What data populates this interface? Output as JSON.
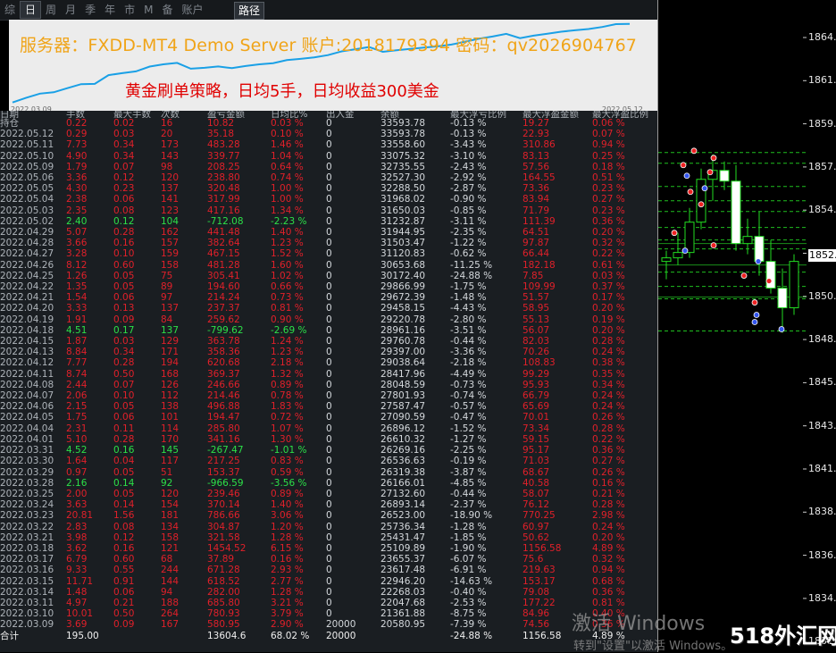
{
  "toolbar": {
    "buttons": [
      "综",
      "日",
      "周",
      "月",
      "季",
      "年",
      "市",
      "M",
      "备",
      "账户"
    ],
    "active": "日",
    "path_label": "路径"
  },
  "equity_chart": {
    "server_line": "服务器：FXDD-MT4 Demo Server  账户:2018179394    密码：qv2026904767",
    "strategy_line": "黄金刷单策略，日均5手，日均收益300美金",
    "start_date": "2022.03.09",
    "end_date": "2022.05.12",
    "line_color": "#1aa0e6",
    "balance_series": [
      20580.95,
      21361.88,
      22047.68,
      22268.03,
      22946.2,
      23617.48,
      23655.37,
      25109.89,
      25431.47,
      25736.34,
      26523.0,
      26893.14,
      27132.6,
      26166.01,
      26319.38,
      26536.63,
      26269.16,
      26610.32,
      26896.12,
      27090.59,
      27587.47,
      27801.93,
      28048.59,
      28417.96,
      29038.64,
      29397.0,
      29760.78,
      28961.16,
      29220.78,
      29458.15,
      29672.39,
      29866.99,
      30172.4,
      30653.68,
      31120.83,
      31503.47,
      31944.95,
      31232.87,
      31650.03,
      31968.02,
      32288.5,
      32527.3,
      32735.55,
      33075.32,
      33558.6,
      33593.78
    ]
  },
  "stats_table": {
    "headers": [
      "日期",
      "手数",
      "最大手数",
      "次数",
      "盈亏金额",
      "日均比%",
      "出入金",
      "余额",
      "最大浮亏比例",
      "最大浮盈金额",
      "最大浮盈比例"
    ],
    "rows": [
      {
        "date": "持仓",
        "lots": "0.22",
        "max_lots": "0.02",
        "trades": "16",
        "pnl": "10.82",
        "pct": "0.03 %",
        "io": "0",
        "balance": "33593.78",
        "dd": "-0.13 %",
        "fp": "19.27",
        "fpp": "0.06 %",
        "neg": false
      },
      {
        "date": "2022.05.12",
        "lots": "0.29",
        "max_lots": "0.03",
        "trades": "20",
        "pnl": "35.18",
        "pct": "0.10 %",
        "io": "0",
        "balance": "33593.78",
        "dd": "-0.13 %",
        "fp": "22.93",
        "fpp": "0.07 %",
        "neg": false
      },
      {
        "date": "2022.05.11",
        "lots": "7.73",
        "max_lots": "0.34",
        "trades": "173",
        "pnl": "483.28",
        "pct": "1.46 %",
        "io": "0",
        "balance": "33558.60",
        "dd": "-3.43 %",
        "fp": "310.86",
        "fpp": "0.94 %",
        "neg": false
      },
      {
        "date": "2022.05.10",
        "lots": "4.90",
        "max_lots": "0.34",
        "trades": "143",
        "pnl": "339.77",
        "pct": "1.04 %",
        "io": "0",
        "balance": "33075.32",
        "dd": "-3.10 %",
        "fp": "83.13",
        "fpp": "0.25 %",
        "neg": false
      },
      {
        "date": "2022.05.09",
        "lots": "1.79",
        "max_lots": "0.07",
        "trades": "98",
        "pnl": "208.25",
        "pct": "0.64 %",
        "io": "0",
        "balance": "32735.55",
        "dd": "-2.43 %",
        "fp": "57.56",
        "fpp": "0.18 %",
        "neg": false
      },
      {
        "date": "2022.05.06",
        "lots": "3.36",
        "max_lots": "0.12",
        "trades": "120",
        "pnl": "238.80",
        "pct": "0.74 %",
        "io": "0",
        "balance": "32527.30",
        "dd": "-2.92 %",
        "fp": "164.55",
        "fpp": "0.51 %",
        "neg": false
      },
      {
        "date": "2022.05.05",
        "lots": "4.30",
        "max_lots": "0.23",
        "trades": "137",
        "pnl": "320.48",
        "pct": "1.00 %",
        "io": "0",
        "balance": "32288.50",
        "dd": "-2.87 %",
        "fp": "73.36",
        "fpp": "0.23 %",
        "neg": false
      },
      {
        "date": "2022.05.04",
        "lots": "2.38",
        "max_lots": "0.06",
        "trades": "141",
        "pnl": "317.99",
        "pct": "1.00 %",
        "io": "0",
        "balance": "31968.02",
        "dd": "-0.90 %",
        "fp": "83.94",
        "fpp": "0.27 %",
        "neg": false
      },
      {
        "date": "2022.05.03",
        "lots": "2.35",
        "max_lots": "0.08",
        "trades": "123",
        "pnl": "417.16",
        "pct": "1.34 %",
        "io": "0",
        "balance": "31650.03",
        "dd": "-0.85 %",
        "fp": "71.79",
        "fpp": "0.23 %",
        "neg": false
      },
      {
        "date": "2022.05.02",
        "lots": "2.40",
        "max_lots": "0.12",
        "trades": "104",
        "pnl": "-712.08",
        "pct": "-2.23 %",
        "io": "0",
        "balance": "31232.87",
        "dd": "-3.11 %",
        "fp": "111.39",
        "fpp": "0.36 %",
        "neg": true
      },
      {
        "date": "2022.04.29",
        "lots": "5.07",
        "max_lots": "0.28",
        "trades": "162",
        "pnl": "441.48",
        "pct": "1.40 %",
        "io": "0",
        "balance": "31944.95",
        "dd": "-2.35 %",
        "fp": "64.51",
        "fpp": "0.20 %",
        "neg": false
      },
      {
        "date": "2022.04.28",
        "lots": "3.66",
        "max_lots": "0.16",
        "trades": "157",
        "pnl": "382.64",
        "pct": "1.23 %",
        "io": "0",
        "balance": "31503.47",
        "dd": "-1.22 %",
        "fp": "97.87",
        "fpp": "0.32 %",
        "neg": false
      },
      {
        "date": "2022.04.27",
        "lots": "3.28",
        "max_lots": "0.10",
        "trades": "159",
        "pnl": "467.15",
        "pct": "1.52 %",
        "io": "0",
        "balance": "31120.83",
        "dd": "-0.62 %",
        "fp": "66.44",
        "fpp": "0.22 %",
        "neg": false
      },
      {
        "date": "2022.04.26",
        "lots": "8.12",
        "max_lots": "0.60",
        "trades": "158",
        "pnl": "481.28",
        "pct": "1.60 %",
        "io": "0",
        "balance": "30653.68",
        "dd": "-11.25 %",
        "fp": "182.18",
        "fpp": "0.61 %",
        "neg": false
      },
      {
        "date": "2022.04.25",
        "lots": "1.26",
        "max_lots": "0.05",
        "trades": "75",
        "pnl": "305.41",
        "pct": "1.02 %",
        "io": "0",
        "balance": "30172.40",
        "dd": "-24.88 %",
        "fp": "7.85",
        "fpp": "0.03 %",
        "neg": false
      },
      {
        "date": "2022.04.22",
        "lots": "1.35",
        "max_lots": "0.05",
        "trades": "89",
        "pnl": "194.60",
        "pct": "0.66 %",
        "io": "0",
        "balance": "29866.99",
        "dd": "-1.75 %",
        "fp": "109.99",
        "fpp": "0.37 %",
        "neg": false
      },
      {
        "date": "2022.04.21",
        "lots": "1.54",
        "max_lots": "0.06",
        "trades": "97",
        "pnl": "214.24",
        "pct": "0.73 %",
        "io": "0",
        "balance": "29672.39",
        "dd": "-1.48 %",
        "fp": "51.57",
        "fpp": "0.17 %",
        "neg": false
      },
      {
        "date": "2022.04.20",
        "lots": "3.33",
        "max_lots": "0.13",
        "trades": "137",
        "pnl": "237.37",
        "pct": "0.81 %",
        "io": "0",
        "balance": "29458.15",
        "dd": "-4.43 %",
        "fp": "58.95",
        "fpp": "0.20 %",
        "neg": false
      },
      {
        "date": "2022.04.19",
        "lots": "1.91",
        "max_lots": "0.09",
        "trades": "84",
        "pnl": "259.62",
        "pct": "0.90 %",
        "io": "0",
        "balance": "29220.78",
        "dd": "-2.80 %",
        "fp": "55.13",
        "fpp": "0.19 %",
        "neg": false
      },
      {
        "date": "2022.04.18",
        "lots": "4.51",
        "max_lots": "0.17",
        "trades": "137",
        "pnl": "-799.62",
        "pct": "-2.69 %",
        "io": "0",
        "balance": "28961.16",
        "dd": "-3.51 %",
        "fp": "56.07",
        "fpp": "0.20 %",
        "neg": true
      },
      {
        "date": "2022.04.15",
        "lots": "1.87",
        "max_lots": "0.03",
        "trades": "129",
        "pnl": "363.78",
        "pct": "1.24 %",
        "io": "0",
        "balance": "29760.78",
        "dd": "-0.44 %",
        "fp": "82.03",
        "fpp": "0.28 %",
        "neg": false
      },
      {
        "date": "2022.04.13",
        "lots": "8.84",
        "max_lots": "0.34",
        "trades": "171",
        "pnl": "358.36",
        "pct": "1.23 %",
        "io": "0",
        "balance": "29397.00",
        "dd": "-3.36 %",
        "fp": "70.26",
        "fpp": "0.24 %",
        "neg": false
      },
      {
        "date": "2022.04.12",
        "lots": "7.77",
        "max_lots": "0.28",
        "trades": "194",
        "pnl": "620.68",
        "pct": "2.18 %",
        "io": "0",
        "balance": "29038.64",
        "dd": "-2.18 %",
        "fp": "108.83",
        "fpp": "0.38 %",
        "neg": false
      },
      {
        "date": "2022.04.11",
        "lots": "8.74",
        "max_lots": "0.50",
        "trades": "168",
        "pnl": "369.37",
        "pct": "1.32 %",
        "io": "0",
        "balance": "28417.96",
        "dd": "-4.49 %",
        "fp": "99.29",
        "fpp": "0.35 %",
        "neg": false
      },
      {
        "date": "2022.04.08",
        "lots": "2.44",
        "max_lots": "0.07",
        "trades": "126",
        "pnl": "246.66",
        "pct": "0.89 %",
        "io": "0",
        "balance": "28048.59",
        "dd": "-0.73 %",
        "fp": "95.93",
        "fpp": "0.34 %",
        "neg": false
      },
      {
        "date": "2022.04.07",
        "lots": "2.06",
        "max_lots": "0.10",
        "trades": "112",
        "pnl": "214.46",
        "pct": "0.78 %",
        "io": "0",
        "balance": "27801.93",
        "dd": "-0.74 %",
        "fp": "66.79",
        "fpp": "0.24 %",
        "neg": false
      },
      {
        "date": "2022.04.06",
        "lots": "2.15",
        "max_lots": "0.05",
        "trades": "138",
        "pnl": "496.88",
        "pct": "1.83 %",
        "io": "0",
        "balance": "27587.47",
        "dd": "-0.57 %",
        "fp": "65.69",
        "fpp": "0.24 %",
        "neg": false
      },
      {
        "date": "2022.04.05",
        "lots": "1.75",
        "max_lots": "0.06",
        "trades": "101",
        "pnl": "194.47",
        "pct": "0.72 %",
        "io": "0",
        "balance": "27090.59",
        "dd": "-0.47 %",
        "fp": "70.01",
        "fpp": "0.26 %",
        "neg": false
      },
      {
        "date": "2022.04.04",
        "lots": "2.31",
        "max_lots": "0.11",
        "trades": "114",
        "pnl": "285.80",
        "pct": "1.07 %",
        "io": "0",
        "balance": "26896.12",
        "dd": "-1.52 %",
        "fp": "73.34",
        "fpp": "0.28 %",
        "neg": false
      },
      {
        "date": "2022.04.01",
        "lots": "5.10",
        "max_lots": "0.28",
        "trades": "170",
        "pnl": "341.16",
        "pct": "1.30 %",
        "io": "0",
        "balance": "26610.32",
        "dd": "-1.27 %",
        "fp": "59.15",
        "fpp": "0.22 %",
        "neg": false
      },
      {
        "date": "2022.03.31",
        "lots": "4.52",
        "max_lots": "0.16",
        "trades": "145",
        "pnl": "-267.47",
        "pct": "-1.01 %",
        "io": "0",
        "balance": "26269.16",
        "dd": "-2.25 %",
        "fp": "95.17",
        "fpp": "0.36 %",
        "neg": true
      },
      {
        "date": "2022.03.30",
        "lots": "1.64",
        "max_lots": "0.04",
        "trades": "117",
        "pnl": "217.25",
        "pct": "0.83 %",
        "io": "0",
        "balance": "26536.63",
        "dd": "-0.19 %",
        "fp": "71.03",
        "fpp": "0.27 %",
        "neg": false
      },
      {
        "date": "2022.03.29",
        "lots": "0.97",
        "max_lots": "0.05",
        "trades": "51",
        "pnl": "153.37",
        "pct": "0.59 %",
        "io": "0",
        "balance": "26319.38",
        "dd": "-3.87 %",
        "fp": "68.67",
        "fpp": "0.26 %",
        "neg": false
      },
      {
        "date": "2022.03.28",
        "lots": "2.16",
        "max_lots": "0.14",
        "trades": "92",
        "pnl": "-966.59",
        "pct": "-3.56 %",
        "io": "0",
        "balance": "26166.01",
        "dd": "-4.85 %",
        "fp": "40.58",
        "fpp": "0.16 %",
        "neg": true
      },
      {
        "date": "2022.03.25",
        "lots": "2.00",
        "max_lots": "0.05",
        "trades": "120",
        "pnl": "239.46",
        "pct": "0.89 %",
        "io": "0",
        "balance": "27132.60",
        "dd": "-0.44 %",
        "fp": "58.07",
        "fpp": "0.21 %",
        "neg": false
      },
      {
        "date": "2022.03.24",
        "lots": "3.63",
        "max_lots": "0.14",
        "trades": "154",
        "pnl": "370.14",
        "pct": "1.40 %",
        "io": "0",
        "balance": "26893.14",
        "dd": "-2.37 %",
        "fp": "76.12",
        "fpp": "0.28 %",
        "neg": false
      },
      {
        "date": "2022.03.23",
        "lots": "20.81",
        "max_lots": "1.56",
        "trades": "181",
        "pnl": "786.66",
        "pct": "3.06 %",
        "io": "0",
        "balance": "26523.00",
        "dd": "-18.90 %",
        "fp": "770.25",
        "fpp": "2.98 %",
        "neg": false
      },
      {
        "date": "2022.03.22",
        "lots": "2.83",
        "max_lots": "0.08",
        "trades": "134",
        "pnl": "304.87",
        "pct": "1.20 %",
        "io": "0",
        "balance": "25736.34",
        "dd": "-1.28 %",
        "fp": "60.97",
        "fpp": "0.24 %",
        "neg": false
      },
      {
        "date": "2022.03.21",
        "lots": "3.98",
        "max_lots": "0.12",
        "trades": "158",
        "pnl": "321.58",
        "pct": "1.28 %",
        "io": "0",
        "balance": "25431.47",
        "dd": "-1.85 %",
        "fp": "50.62",
        "fpp": "0.20 %",
        "neg": false
      },
      {
        "date": "2022.03.18",
        "lots": "3.62",
        "max_lots": "0.16",
        "trades": "121",
        "pnl": "1454.52",
        "pct": "6.15 %",
        "io": "0",
        "balance": "25109.89",
        "dd": "-1.90 %",
        "fp": "1156.58",
        "fpp": "4.89 %",
        "neg": false
      },
      {
        "date": "2022.03.17",
        "lots": "6.79",
        "max_lots": "0.60",
        "trades": "68",
        "pnl": "37.89",
        "pct": "0.16 %",
        "io": "0",
        "balance": "23655.37",
        "dd": "-6.07 %",
        "fp": "75.6",
        "fpp": "0.32 %",
        "neg": false
      },
      {
        "date": "2022.03.16",
        "lots": "9.33",
        "max_lots": "0.55",
        "trades": "244",
        "pnl": "671.28",
        "pct": "2.93 %",
        "io": "0",
        "balance": "23617.48",
        "dd": "-6.91 %",
        "fp": "219.63",
        "fpp": "0.94 %",
        "neg": false
      },
      {
        "date": "2022.03.15",
        "lots": "11.71",
        "max_lots": "0.91",
        "trades": "144",
        "pnl": "618.52",
        "pct": "2.77 %",
        "io": "0",
        "balance": "22946.20",
        "dd": "-14.63 %",
        "fp": "153.17",
        "fpp": "0.68 %",
        "neg": false
      },
      {
        "date": "2022.03.14",
        "lots": "1.48",
        "max_lots": "0.06",
        "trades": "94",
        "pnl": "282.00",
        "pct": "1.28 %",
        "io": "0",
        "balance": "22268.03",
        "dd": "-0.40 %",
        "fp": "79.08",
        "fpp": "0.36 %",
        "neg": false
      },
      {
        "date": "2022.03.11",
        "lots": "4.97",
        "max_lots": "0.21",
        "trades": "188",
        "pnl": "685.80",
        "pct": "3.21 %",
        "io": "0",
        "balance": "22047.68",
        "dd": "-2.53 %",
        "fp": "177.22",
        "fpp": "0.81 %",
        "neg": false
      },
      {
        "date": "2022.03.10",
        "lots": "10.01",
        "max_lots": "0.50",
        "trades": "264",
        "pnl": "780.93",
        "pct": "3.79 %",
        "io": "0",
        "balance": "21361.88",
        "dd": "-8.75 %",
        "fp": "84.96",
        "fpp": "0.40 %",
        "neg": false
      },
      {
        "date": "2022.03.09",
        "lots": "3.69",
        "max_lots": "0.09",
        "trades": "167",
        "pnl": "580.95",
        "pct": "2.90 %",
        "io": "20000",
        "balance": "20580.95",
        "dd": "-7.39 %",
        "fp": "74.56",
        "fpp": "0.36 %",
        "neg": false
      }
    ],
    "total": {
      "label": "合计",
      "lots": "195.00",
      "pnl": "13604.6",
      "pct": "68.02 %",
      "io": "20000",
      "dd": "-24.88 %",
      "fp": "1156.58",
      "fpp": "4.89 %"
    }
  },
  "price_chart": {
    "price_labels": [
      "1864.",
      "1861.",
      "1859.",
      "1857.",
      "1854.",
      "1852.",
      "1850.",
      "1848.",
      "1845.",
      "1843.",
      "1841.",
      "1838.",
      "1836.",
      "1834.",
      "1831."
    ],
    "current_price": "1852.",
    "ylim": [
      1830.3,
      1865.0
    ],
    "candles": [
      {
        "open": 1852.0,
        "high": 1852.6,
        "low": 1851.0,
        "close": 1852.2,
        "bull": true
      },
      {
        "open": 1852.2,
        "high": 1853.6,
        "low": 1851.8,
        "close": 1852.5,
        "bull": true
      },
      {
        "open": 1852.5,
        "high": 1855.0,
        "low": 1852.2,
        "close": 1854.2,
        "bull": true
      },
      {
        "open": 1854.2,
        "high": 1857.2,
        "low": 1853.8,
        "close": 1856.6,
        "bull": true
      },
      {
        "open": 1856.6,
        "high": 1858.0,
        "low": 1855.4,
        "close": 1857.1,
        "bull": true
      },
      {
        "open": 1857.1,
        "high": 1857.6,
        "low": 1856.0,
        "close": 1856.5,
        "bull": false
      },
      {
        "open": 1856.5,
        "high": 1857.4,
        "low": 1852.6,
        "close": 1853.0,
        "bull": false
      },
      {
        "open": 1853.0,
        "high": 1854.4,
        "low": 1852.4,
        "close": 1853.4,
        "bull": true
      },
      {
        "open": 1853.4,
        "high": 1854.8,
        "low": 1851.2,
        "close": 1852.0,
        "bull": false
      },
      {
        "open": 1852.0,
        "high": 1853.2,
        "low": 1850.2,
        "close": 1850.5,
        "bull": false
      },
      {
        "open": 1850.5,
        "high": 1851.6,
        "low": 1848.0,
        "close": 1849.4,
        "bull": false
      },
      {
        "open": 1849.4,
        "high": 1852.4,
        "low": 1849.0,
        "close": 1852.0,
        "bull": true
      }
    ]
  },
  "watermarks": {
    "activate_title": "激活 Windows",
    "activate_sub": "转到\"设置\"以激活 Windows。",
    "site_logo": "518外汇网"
  }
}
